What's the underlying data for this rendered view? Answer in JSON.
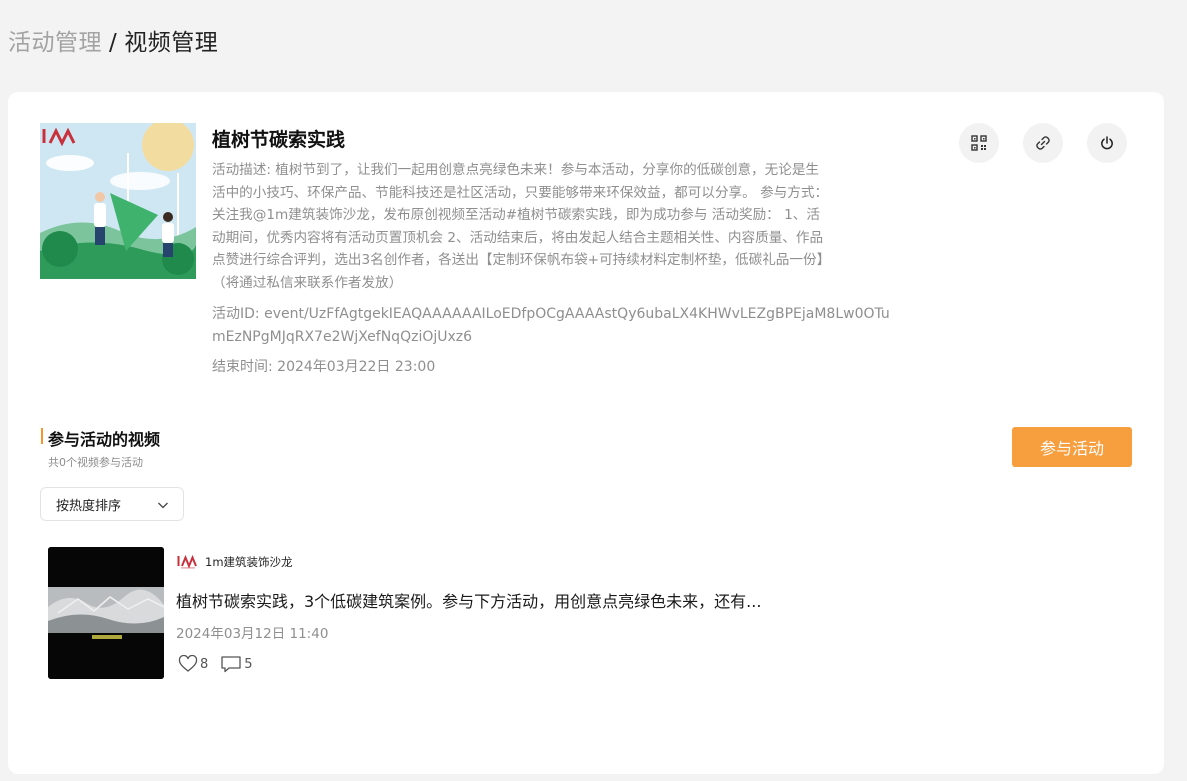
{
  "breadcrumb": {
    "parent": "活动管理",
    "separator": "/",
    "current": "视频管理"
  },
  "activity": {
    "title": "植树节碳索实践",
    "description": "活动描述: 植树节到了，让我们一起用创意点亮绿色未来！参与本活动，分享你的低碳创意，无论是生\n活中的小技巧、环保产品、节能科技还是社区活动，只要能够带来环保效益，都可以分享。 参与方式：\n关注我@1m建筑装饰沙龙，发布原创视频至活动#植树节碳索实践，即为成功参与 活动奖励： 1、活\n动期间，优秀内容将有活动页置顶机会 2、活动结束后，将由发起人结合主题相关性、内容质量、作品\n点赞进行综合评判，选出3名创作者，各送出【定制环保帆布袋+可持续材料定制杯垫，低碳礼品一份】\n（将通过私信来联系作者发放）",
    "id_text": "活动ID: event/UzFfAgtgekIEAQAAAAAAILoEDfpOCgAAAAstQy6ubaLX4KHWvLEZgBPEjaM8Lw0OTumEzNPgMJqRX7e2WjXefNqQziOjUxz6",
    "end_time": "结束时间: 2024年03月22日 23:00"
  },
  "actions": {
    "qrcode_icon": "qrcode-icon",
    "link_icon": "link-icon",
    "power_icon": "power-icon"
  },
  "section": {
    "title": "参与活动的视频",
    "subtitle": "共0个视频参与活动",
    "join_label": "参与活动",
    "sort_selected": "按热度排序"
  },
  "videos": [
    {
      "author": "1m建筑装饰沙龙",
      "title": "植树节碳索实践，3个低碳建筑案例。参与下方活动，用创意点亮绿色未来，还有...",
      "date": "2024年03月12日 11:40",
      "likes": "8",
      "comments": "5"
    }
  ],
  "colors": {
    "accent": "#f79e3f",
    "breadcrumb_parent": "#a3a3a3",
    "brand_red": "#c8313c"
  }
}
